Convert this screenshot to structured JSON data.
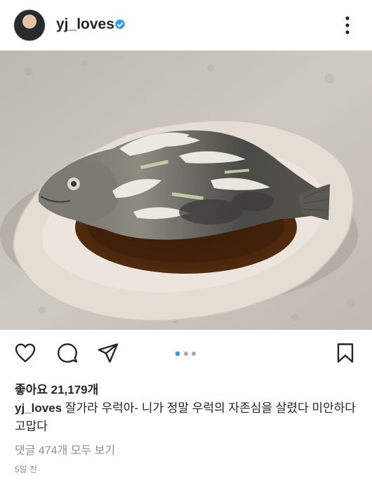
{
  "post": {
    "username": "yj_loves",
    "verified": true,
    "likes_text": "좋아요 21,179개",
    "caption_user": "yj_loves",
    "caption_text": " 잘가라 우럭아-  니가 정말 우럭의 자존심을 살렸다 미안하다 고맙다",
    "comments_link": "댓글 474개 모두 보기",
    "time_ago": "5일 전"
  },
  "carousel": {
    "count": 3,
    "active_index": 0
  },
  "colors": {
    "accent": "#3897f0",
    "muted": "#8e8e8e",
    "text": "#262626"
  }
}
